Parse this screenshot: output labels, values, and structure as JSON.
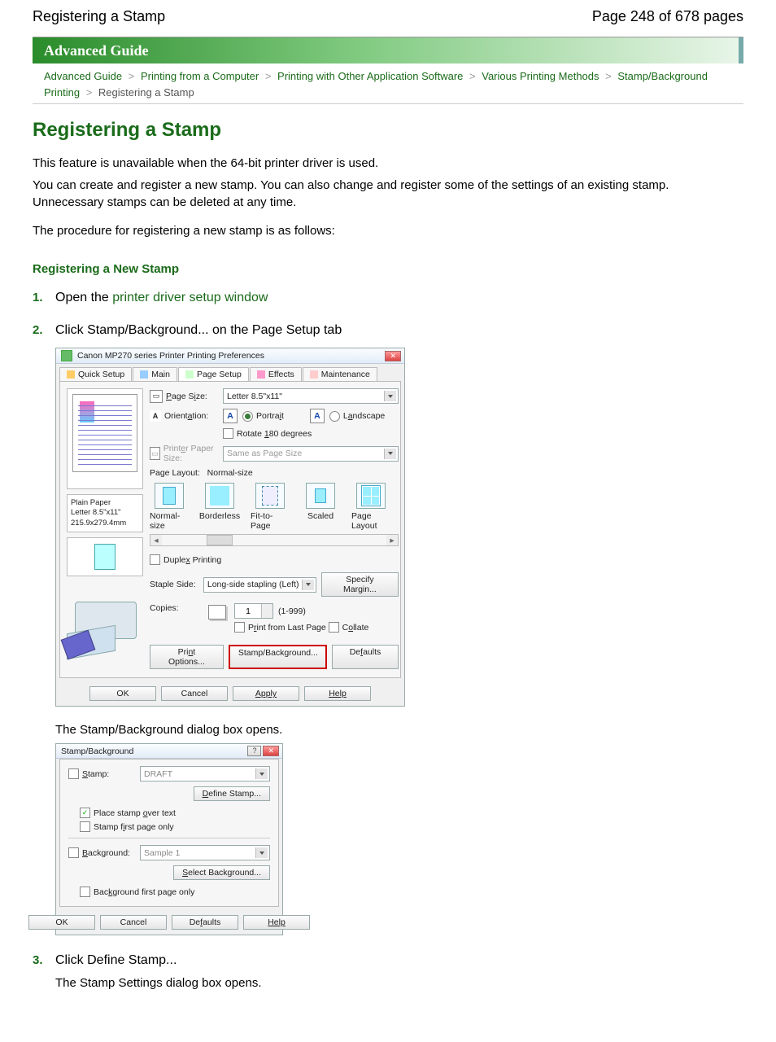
{
  "header": {
    "title": "Registering a Stamp",
    "page_info": "Page 248 of 678 pages"
  },
  "banner": "Advanced Guide",
  "breadcrumb": {
    "items": [
      "Advanced Guide",
      "Printing from a Computer",
      "Printing with Other Application Software",
      "Various Printing Methods",
      "Stamp/Background Printing"
    ],
    "current": "Registering a Stamp",
    "sep": ">"
  },
  "title": "Registering a Stamp",
  "intro": [
    "This feature is unavailable when the 64-bit printer driver is used.",
    "You can create and register a new stamp. You can also change and register some of the settings of an existing stamp. Unnecessary stamps can be deleted at any time.",
    "The procedure for registering a new stamp is as follows:"
  ],
  "section": "Registering a New Stamp",
  "steps": [
    {
      "n": "1.",
      "lead": "Open the ",
      "link": "printer driver setup window"
    },
    {
      "n": "2.",
      "title": "Click Stamp/Background... on the Page Setup tab",
      "after": "The Stamp/Background dialog box opens."
    },
    {
      "n": "3.",
      "title": "Click Define Stamp...",
      "after": "The Stamp Settings dialog box opens."
    }
  ],
  "dlg1": {
    "title": "Canon MP270 series Printer Printing Preferences",
    "tabs": [
      "Quick Setup",
      "Main",
      "Page Setup",
      "Effects",
      "Maintenance"
    ],
    "active_tab": 2,
    "media": {
      "l1": "Plain Paper",
      "l2": "Letter 8.5\"x11\" 215.9x279.4mm"
    },
    "page_size": {
      "label": "Page Size:",
      "value": "Letter 8.5\"x11\""
    },
    "orientation": {
      "label": "Orientation:",
      "portrait": "Portrait",
      "landscape": "Landscape",
      "rotate": "Rotate 180 degrees"
    },
    "printer_paper": {
      "label": "Printer Paper Size:",
      "value": "Same as Page Size"
    },
    "page_layout_label": "Page Layout:",
    "page_layout_value": "Normal-size",
    "layouts": [
      "Normal-size",
      "Borderless",
      "Fit-to-Page",
      "Scaled",
      "Page Layout"
    ],
    "duplex": "Duplex Printing",
    "staple": {
      "label": "Staple Side:",
      "value": "Long-side stapling (Left)",
      "btn": "Specify Margin..."
    },
    "copies": {
      "label": "Copies:",
      "value": "1",
      "range": "(1-999)",
      "opt1": "Print from Last Page",
      "opt2": "Collate"
    },
    "actions": {
      "print_opt": "Print Options...",
      "stamp": "Stamp/Background...",
      "defaults": "Defaults"
    },
    "footer": [
      "OK",
      "Cancel",
      "Apply",
      "Help"
    ]
  },
  "dlg2": {
    "title": "Stamp/Background",
    "stamp_chk": "Stamp:",
    "stamp_val": "DRAFT",
    "define": "Define Stamp...",
    "over": "Place stamp over text",
    "first": "Stamp first page only",
    "bg_chk": "Background:",
    "bg_val": "Sample 1",
    "select_bg": "Select Background...",
    "bg_first": "Background first page only",
    "footer": [
      "OK",
      "Cancel",
      "Defaults",
      "Help"
    ]
  }
}
